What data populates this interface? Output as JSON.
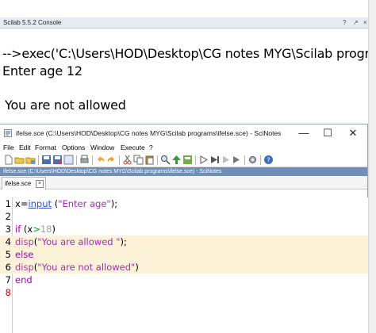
{
  "console": {
    "title": "Scilab 5.5.2 Console",
    "controls": [
      "?",
      "↗",
      "×"
    ],
    "lines": [
      "-->exec('C:\\Users\\HOD\\Desktop\\CG notes MYG\\Scilab programs\\if",
      "Enter age 12",
      "You are not allowed"
    ]
  },
  "scinotes": {
    "window_title": "ifelse.sce (C:\\Users\\HOD\\Desktop\\CG notes MYG\\Scilab programs\\ifelse.sce) - SciNotes",
    "minimize": "—",
    "maximize": "☐",
    "close": "✕",
    "menu": [
      "File",
      "Edit",
      "Format",
      "Options",
      "Window",
      "Execute",
      "?"
    ],
    "path_bar": "ifelse.sce (C:\\Users\\HOD\\Desktop\\CG notes MYG\\Scilab programs\\ifelse.sce) - SciNotes",
    "tab_label": "ifelse.sce",
    "tab_close": "×",
    "code": {
      "line_numbers": [
        "1",
        "2",
        "3",
        "4",
        "5",
        "6",
        "7",
        "8"
      ],
      "l1_var": "x",
      "l1_eq": "=",
      "l1_fn": "input",
      "l1_open": " (",
      "l1_str": "\"Enter age\"",
      "l1_close": ");",
      "l3_kw": "if",
      "l3_open": " (x",
      "l3_op": ">",
      "l3_num": "18",
      "l3_close": ")",
      "l4_fn": "disp",
      "l4_open": "(",
      "l4_str": "\"You are allowed \"",
      "l4_close": ");",
      "l5_kw": "else",
      "l6_fn": "disp",
      "l6_open": "(",
      "l6_str": "\"You are not allowed\"",
      "l6_close": ")",
      "l7_kw": "end"
    }
  },
  "colors": {
    "keyword": "#b000b0",
    "string": "#a030b0",
    "operator": "#00a000",
    "highlight": "#fbf2d8",
    "path_bar": "#6e8fb8"
  }
}
